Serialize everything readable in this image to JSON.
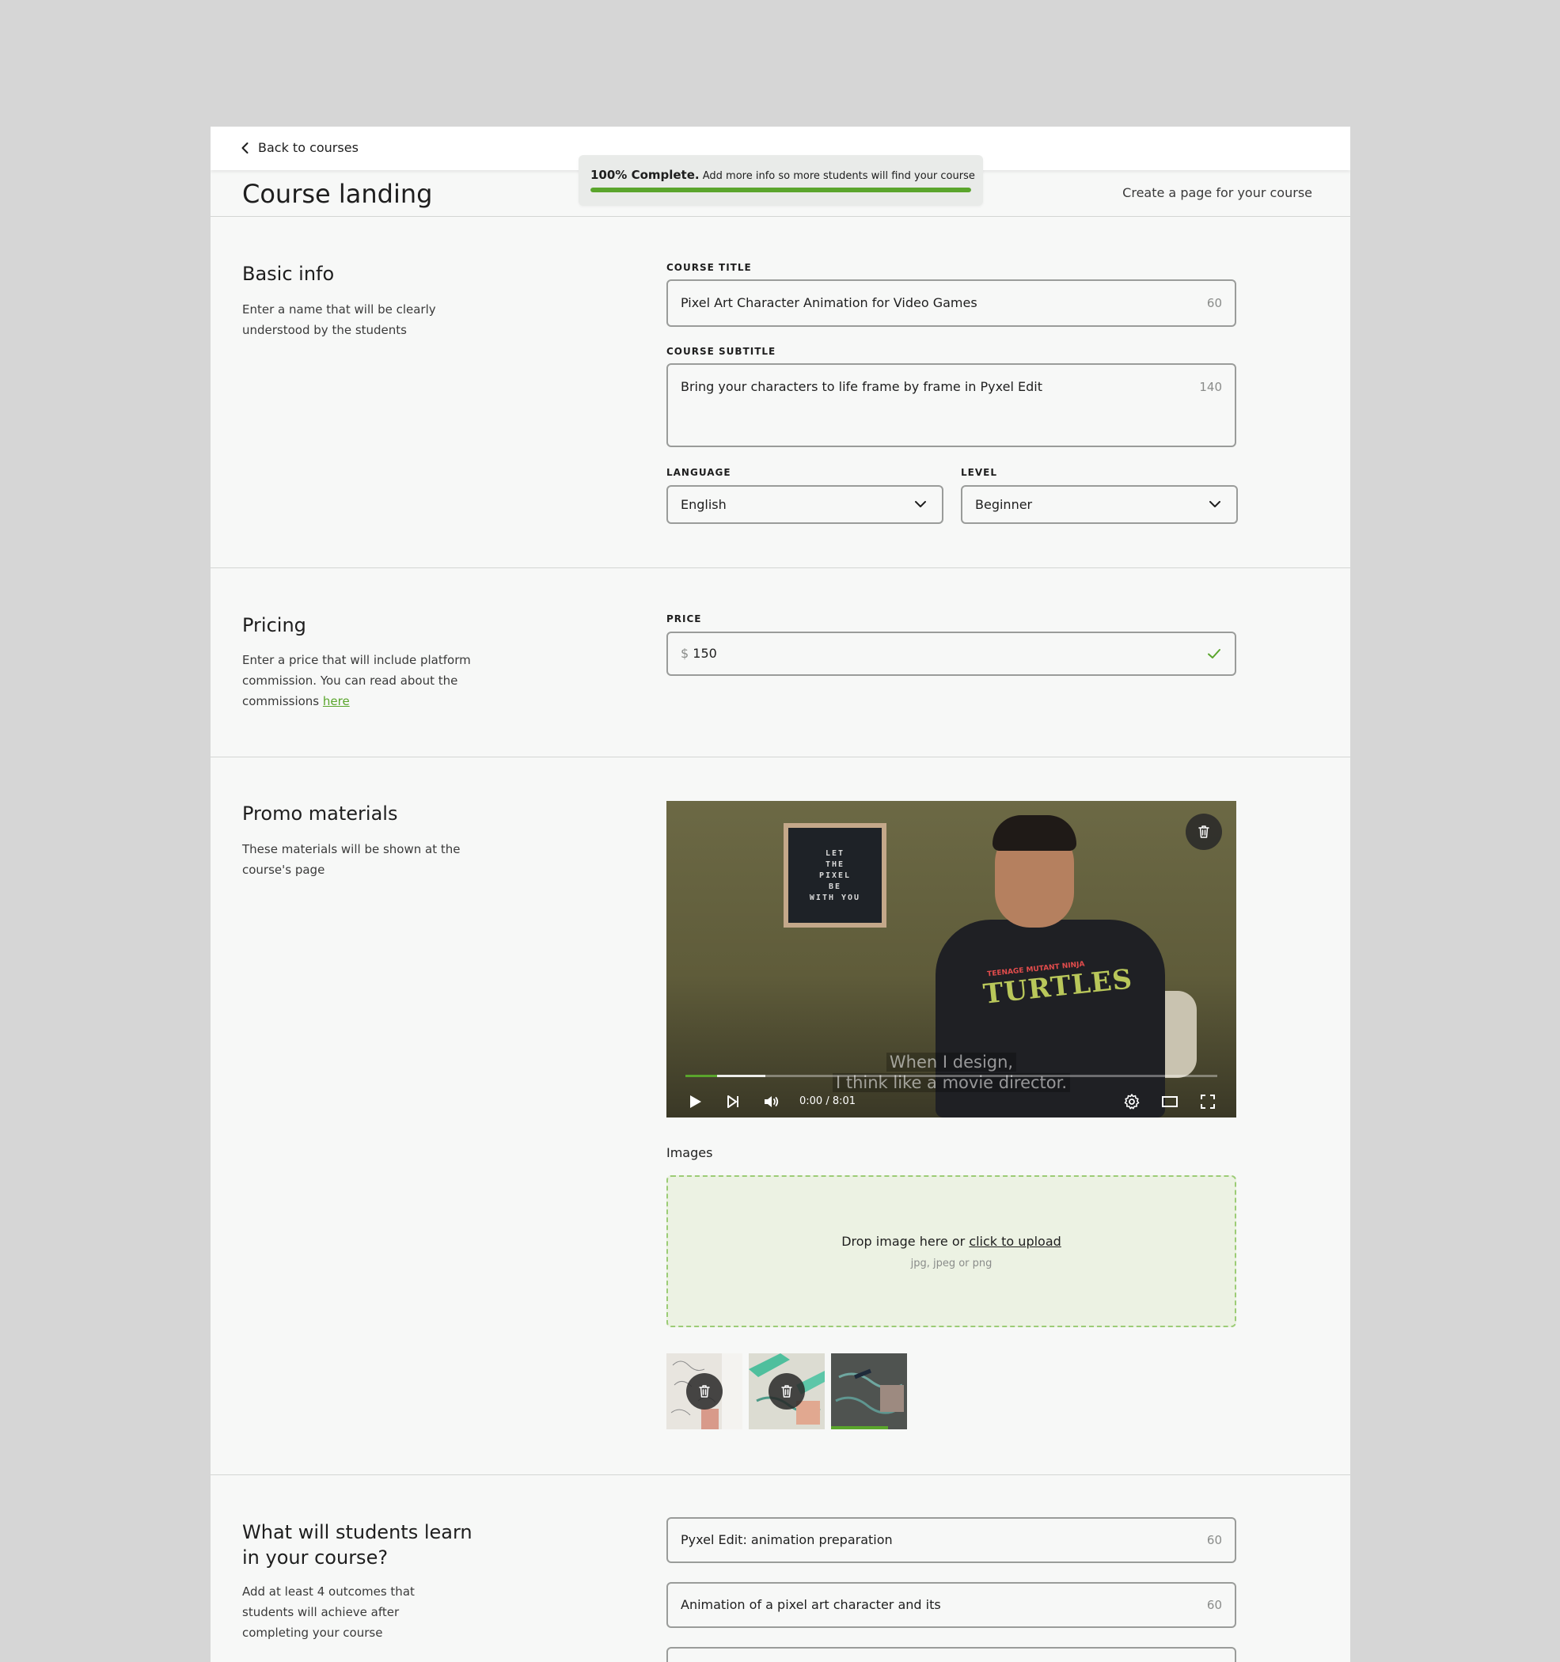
{
  "topbar": {
    "back_label": "Back to courses"
  },
  "header": {
    "title": "Course landing",
    "subtitle": "Create a page for your course"
  },
  "progress": {
    "percent": 100,
    "title": "100% Complete.",
    "message": "Add more info so more students will find your course"
  },
  "basic_info": {
    "title": "Basic info",
    "description": "Enter a name that will be clearly understood by the students",
    "course_title_label": "COURSE TITLE",
    "course_title_value": "Pixel Art Character Animation for Video Games",
    "course_title_count": "60",
    "course_subtitle_label": "COURSE SUBTITLE",
    "course_subtitle_value": "Bring your characters to life frame by frame in Pyxel Edit",
    "course_subtitle_count": "140",
    "language_label": "LANGUAGE",
    "language_value": "English",
    "level_label": "LEVEL",
    "level_value": "Beginner"
  },
  "pricing": {
    "title": "Pricing",
    "description": "Enter a price that will include platform commission. You can read about the commissions",
    "link": "here",
    "price_label": "PRICE",
    "currency": "$",
    "price_value": "150"
  },
  "promo": {
    "title": "Promo materials",
    "description": "These materials will be shown at the course's page",
    "video": {
      "board_lines": [
        "LET",
        "THE",
        "PIXEL",
        "BE",
        "WITH YOU"
      ],
      "shirt_top": "TEENAGE MUTANT NINJA",
      "shirt_logo": "TURTLES",
      "subtitle_line1": "When I design,",
      "subtitle_line2": "I think like a movie director.",
      "time": "0:00 / 8:01",
      "buffered_fraction": 0.15,
      "played_fraction": 0.06
    },
    "images_label": "Images",
    "drop_text": "Drop image here or",
    "drop_link": "click to upload",
    "drop_formats": "jpg, jpeg or png",
    "thumb3_progress_fraction": 0.75
  },
  "outcomes": {
    "title": "What will students learn in your course?",
    "description": "Add at least 4 outcomes that students will achieve after completing your course",
    "items": [
      {
        "value": "Pyxel Edit: animation preparation",
        "count": "60"
      },
      {
        "value": "Animation of a pixel art character and its",
        "count": "60"
      }
    ]
  },
  "colors": {
    "accent": "#5aa52c",
    "page_bg": "#f7f8f7",
    "backdrop": "#d6d6d6"
  }
}
